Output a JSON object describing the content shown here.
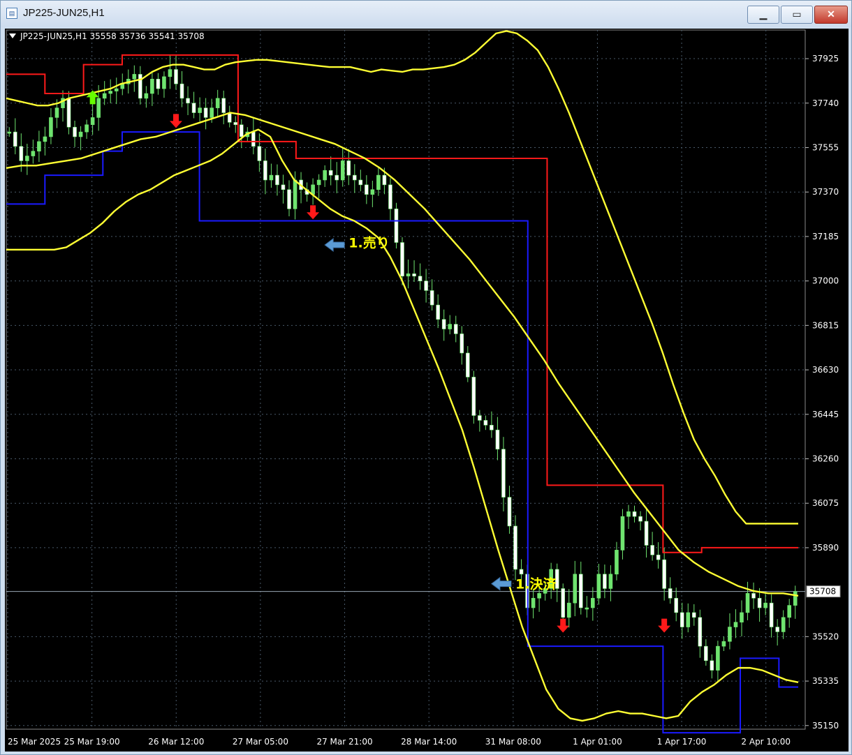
{
  "window": {
    "title": "JP225-JUN25,H1",
    "icon": "chart-window-icon",
    "controls": {
      "minimize": "minimize-icon",
      "maximize": "maximize-icon",
      "close": "close-icon"
    }
  },
  "info_bar": "JP225-JUN25,H1  35558 35736 35541 35708",
  "colors": {
    "background": "#000000",
    "grid": "#4a5a6a",
    "bull": "#6fe46f",
    "bear": "#ffffff",
    "bands": "#ffff33",
    "upper_channel": "#ff1a1a",
    "lower_channel": "#1a1aff",
    "annotation": "#ffff00",
    "entry_arrow": "#5b9bd5",
    "sell_signal": "#ff1a1a",
    "buy_signal": "#66ff00"
  },
  "chart_data": {
    "type": "candlestick",
    "symbol": "JP225-JUN25",
    "timeframe": "H1",
    "last": {
      "open": 35558,
      "high": 35736,
      "low": 35541,
      "close": 35708
    },
    "ylim": [
      35100,
      38050
    ],
    "y_ticks": [
      37925,
      37740,
      37555,
      37370,
      37185,
      37000,
      36815,
      36630,
      36445,
      36260,
      36075,
      35890,
      35708,
      35520,
      35335,
      35150
    ],
    "current_price_label": "35708",
    "x_ticks": [
      "25 Mar 2025",
      "25 Mar 19:00",
      "26 Mar 12:00",
      "27 Mar 05:00",
      "27 Mar 21:00",
      "28 Mar 14:00",
      "31 Mar 08:00",
      "1 Apr 01:00",
      "1 Apr 17:00",
      "2 Apr 10:00"
    ],
    "bar_count": 113,
    "closes": [
      37620,
      37560,
      37500,
      37520,
      37540,
      37580,
      37600,
      37680,
      37720,
      37760,
      37640,
      37600,
      37620,
      37650,
      37680,
      37760,
      37780,
      37790,
      37800,
      37820,
      37840,
      37860,
      37760,
      37780,
      37840,
      37800,
      37850,
      37880,
      37820,
      37760,
      37740,
      37700,
      37720,
      37680,
      37720,
      37760,
      37700,
      37660,
      37650,
      37600,
      37620,
      37560,
      37500,
      37420,
      37440,
      37400,
      37380,
      37300,
      37420,
      37380,
      37360,
      37400,
      37420,
      37460,
      37440,
      37420,
      37500,
      37440,
      37420,
      37400,
      37360,
      37380,
      37440,
      37400,
      37300,
      37160,
      37020,
      37030,
      37020,
      37000,
      36960,
      36900,
      36840,
      36800,
      36820,
      36780,
      36700,
      36600,
      36440,
      36420,
      36400,
      36380,
      36300,
      36100,
      35980,
      35800,
      35780,
      35640,
      35680,
      35700,
      35720,
      35800,
      35720,
      35600,
      35660,
      35780,
      35640,
      35640,
      35680,
      35780,
      35720,
      35780,
      35880,
      36020,
      36040,
      36020,
      36000,
      35900,
      35860,
      35840,
      35720,
      35680,
      35620,
      35560,
      35620,
      35600,
      35480,
      35420,
      35380,
      35480,
      35500,
      35560,
      35580,
      35620,
      35700,
      35680,
      35640,
      35660,
      35560,
      35540,
      35600,
      35650,
      35708
    ],
    "upper_band": [
      37760,
      37750,
      37740,
      37730,
      37730,
      37740,
      37760,
      37770,
      37780,
      37790,
      37800,
      37820,
      37830,
      37840,
      37870,
      37890,
      37900,
      37900,
      37890,
      37880,
      37880,
      37900,
      37910,
      37915,
      37920,
      37920,
      37915,
      37910,
      37905,
      37900,
      37895,
      37890,
      37890,
      37890,
      37880,
      37870,
      37880,
      37875,
      37870,
      37880,
      37880,
      37885,
      37890,
      37900,
      37920,
      37950,
      37990,
      38030,
      38040,
      38030,
      38000,
      37960,
      37890,
      37800,
      37700,
      37590,
      37480,
      37370,
      37260,
      37150,
      37040,
      36930,
      36820,
      36700,
      36570,
      36450,
      36340,
      36260,
      36190,
      36110,
      36040,
      35990,
      35990,
      35990,
      35990,
      35990,
      35990
    ],
    "middle_band": [
      37470,
      37480,
      37480,
      37490,
      37500,
      37510,
      37530,
      37550,
      37570,
      37590,
      37600,
      37620,
      37640,
      37660,
      37680,
      37700,
      37690,
      37670,
      37650,
      37630,
      37610,
      37590,
      37570,
      37540,
      37510,
      37470,
      37420,
      37360,
      37300,
      37230,
      37160,
      37090,
      37010,
      36930,
      36850,
      36760,
      36670,
      36570,
      36480,
      36390,
      36300,
      36210,
      36120,
      36040,
      35960,
      35880,
      35830,
      35790,
      35760,
      35730,
      35710,
      35700,
      35700,
      35690
    ],
    "lower_band": [
      37130,
      37130,
      37130,
      37130,
      37130,
      37140,
      37170,
      37200,
      37240,
      37290,
      37330,
      37360,
      37380,
      37410,
      37440,
      37460,
      37480,
      37500,
      37530,
      37570,
      37610,
      37630,
      37600,
      37500,
      37420,
      37380,
      37340,
      37300,
      37270,
      37250,
      37220,
      37180,
      37100,
      37000,
      36880,
      36760,
      36640,
      36510,
      36380,
      36220,
      36050,
      35880,
      35720,
      35560,
      35430,
      35300,
      35220,
      35180,
      35170,
      35180,
      35200,
      35210,
      35200,
      35200,
      35190,
      35180,
      35190,
      35250,
      35290,
      35320,
      35360,
      35390,
      35390,
      35380,
      35360,
      35340,
      35330
    ],
    "upper_channel": [
      37860,
      37860,
      37780,
      37780,
      37900,
      37900,
      37940,
      37940,
      37940,
      37940,
      37940,
      37940,
      37580,
      37580,
      37580,
      37510,
      37510,
      37510,
      37510,
      37510,
      37510,
      37510,
      37510,
      37510,
      37510,
      37510,
      37510,
      37510,
      36150,
      36150,
      36150,
      36150,
      36150,
      36150,
      35870,
      35870,
      35890,
      35890,
      35890,
      35890,
      35890
    ],
    "lower_channel": [
      37320,
      37320,
      37440,
      37440,
      37440,
      37540,
      37620,
      37620,
      37620,
      37620,
      37250,
      37250,
      37250,
      37250,
      37250,
      37250,
      37250,
      37250,
      37250,
      37250,
      37250,
      37250,
      37250,
      37250,
      37250,
      37250,
      37250,
      35480,
      35480,
      35480,
      35480,
      35480,
      35480,
      35480,
      35120,
      35120,
      35120,
      35120,
      35430,
      35430,
      35310
    ],
    "annotations": [
      {
        "text": "1.売り",
        "bar": 57,
        "price": 37160
      },
      {
        "text": "1.決済",
        "bar": 85,
        "price": 35740
      }
    ],
    "signals": [
      {
        "kind": "buy",
        "bar": 14,
        "price": 37770
      },
      {
        "kind": "sell",
        "bar": 28,
        "price": 37660
      },
      {
        "kind": "sell",
        "bar": 51,
        "price": 37280
      },
      {
        "kind": "sell",
        "bar": 93,
        "price": 35560
      },
      {
        "kind": "sell",
        "bar": 110,
        "price": 35560
      }
    ],
    "entry_arrows": [
      {
        "bar": 53,
        "price": 37150
      },
      {
        "bar": 81,
        "price": 35740
      }
    ],
    "grid": true
  }
}
